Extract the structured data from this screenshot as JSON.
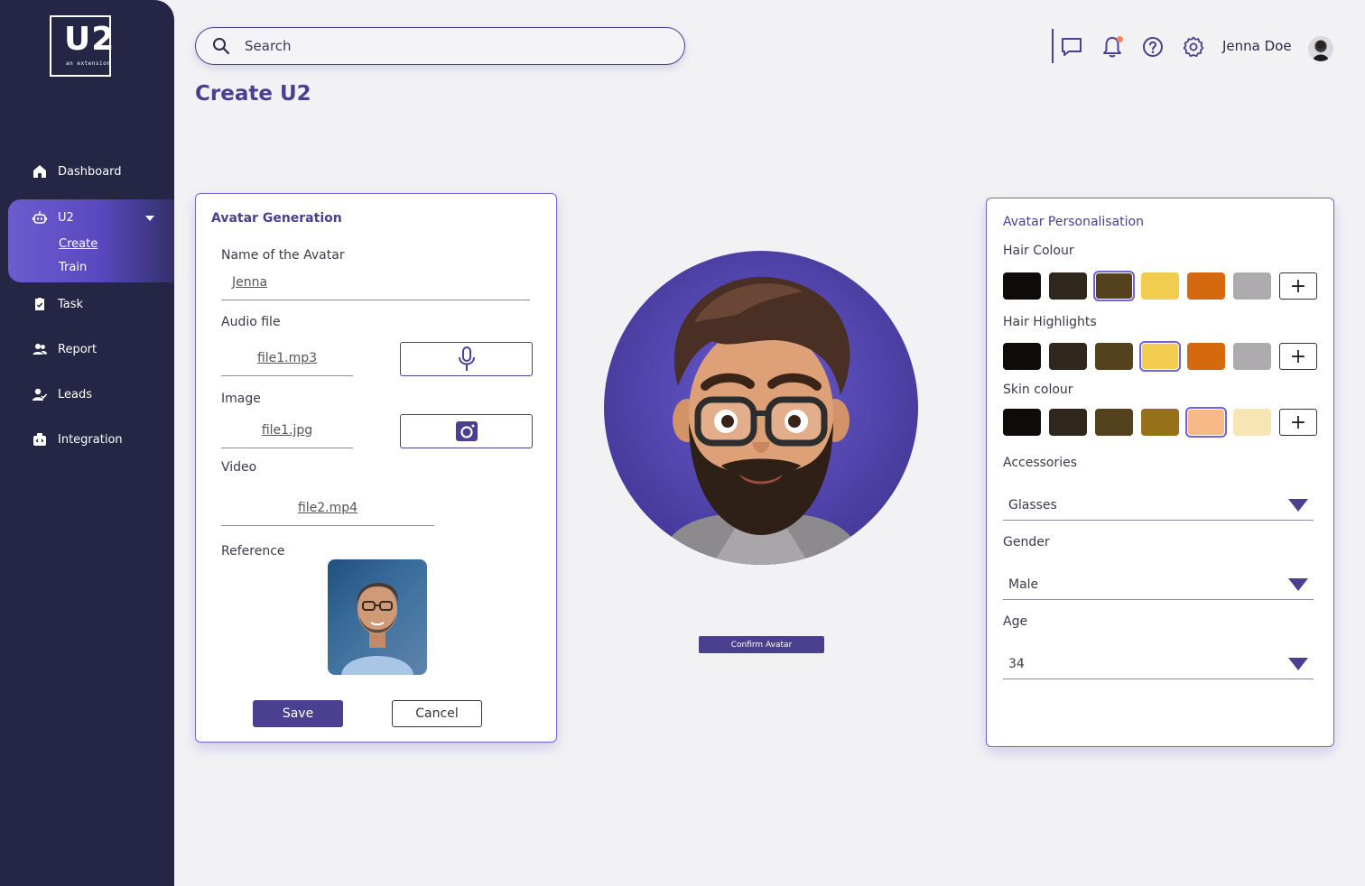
{
  "brand": {
    "logo_text": "U2",
    "logo_subtext": "an extension"
  },
  "sidebar": {
    "items": [
      {
        "label": "Dashboard",
        "icon": "home-icon"
      },
      {
        "label": "U2",
        "icon": "robot-icon"
      },
      {
        "label": "Task",
        "icon": "clipboard-icon"
      },
      {
        "label": "Report",
        "icon": "users-icon"
      },
      {
        "label": "Leads",
        "icon": "user-check-icon"
      },
      {
        "label": "Integration",
        "icon": "plug-box-icon"
      }
    ],
    "subitems": [
      {
        "label": "Create"
      },
      {
        "label": "Train"
      }
    ]
  },
  "header": {
    "search_placeholder": "Search",
    "user_name": "Jenna Doe"
  },
  "page": {
    "title": "Create U2"
  },
  "avatar_generation": {
    "title": "Avatar Generation",
    "name_label": "Name of the Avatar",
    "name_value": "Jenna",
    "audio_label": "Audio file",
    "audio_value": "file1.mp3",
    "image_label": "Image",
    "image_value": "file1.jpg",
    "video_label": "Video",
    "video_value": "file2.mp4",
    "reference_label": "Reference",
    "save_label": "Save",
    "cancel_label": "Cancel"
  },
  "center": {
    "confirm_label": "Confirm Avatar"
  },
  "personalisation": {
    "title": "Avatar Personalisation",
    "hair_colour_label": "Hair Colour",
    "hair_colours": [
      "#0e0b0a",
      "#2f261c",
      "#54421e",
      "#f1cc4f",
      "#d5690f",
      "#aeabae"
    ],
    "hair_colour_selected": 2,
    "hair_highlights_label": "Hair Highlights",
    "hair_highlights": [
      "#0e0b0a",
      "#2f261c",
      "#54421e",
      "#f1cc4f",
      "#d5690f",
      "#aeabae"
    ],
    "hair_highlights_selected": 3,
    "skin_colour_label": "Skin colour",
    "skin_colours": [
      "#0e0b0a",
      "#2f261c",
      "#54421e",
      "#977119",
      "#f7b986",
      "#f7e6b3"
    ],
    "skin_colour_selected": 4,
    "add_symbol": "+",
    "accessories_label": "Accessories",
    "accessories_value": "Glasses",
    "gender_label": "Gender",
    "gender_value": "Male",
    "age_label": "Age",
    "age_value": "34"
  },
  "colors": {
    "accent": "#4b3f8f",
    "sidebar_bg": "#252545",
    "page_bg": "#f2f2f5"
  }
}
